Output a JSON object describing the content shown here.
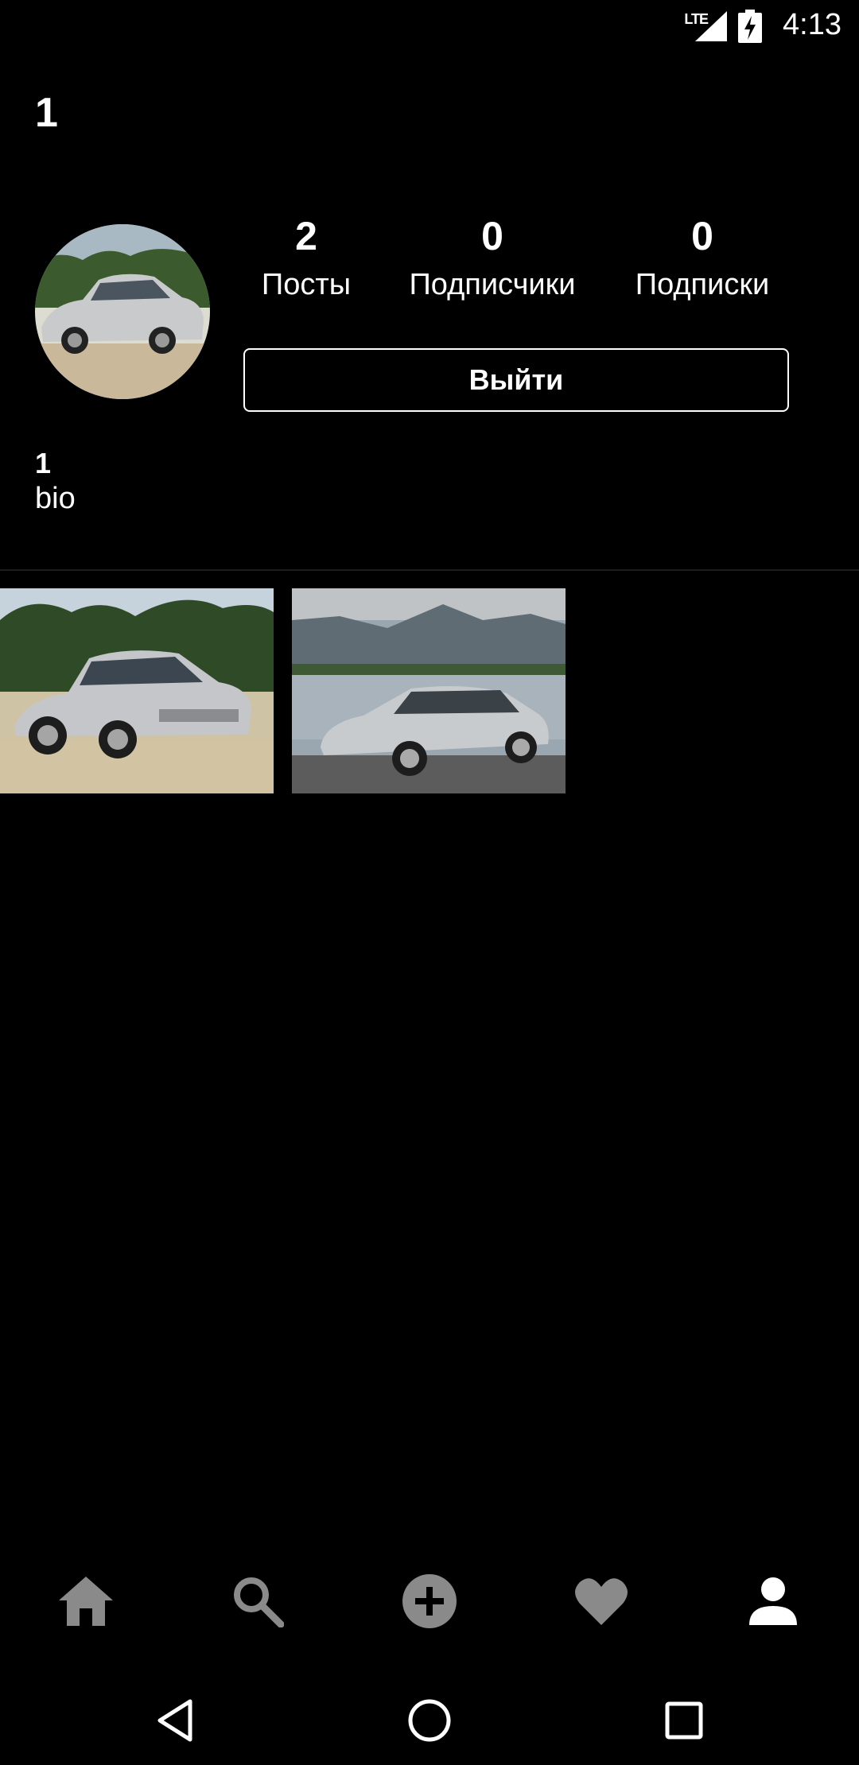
{
  "status_bar": {
    "network": "LTE",
    "time": "4:13"
  },
  "header": {
    "username": "1"
  },
  "profile": {
    "stats": [
      {
        "count": "2",
        "label": "Посты"
      },
      {
        "count": "0",
        "label": "Подписчики"
      },
      {
        "count": "0",
        "label": "Подписки"
      }
    ],
    "logout_label": "Выйти",
    "display_name": "1",
    "bio": "bio"
  },
  "posts_count_shown": 2,
  "bottom_nav": {
    "items": [
      "home-icon",
      "search-icon",
      "add-icon",
      "heart-icon",
      "person-icon"
    ],
    "active": "person-icon",
    "active_color": "#ffffff",
    "inactive_color": "#8a8a8a"
  },
  "system_nav": {
    "buttons": [
      "back",
      "home",
      "recents"
    ]
  }
}
